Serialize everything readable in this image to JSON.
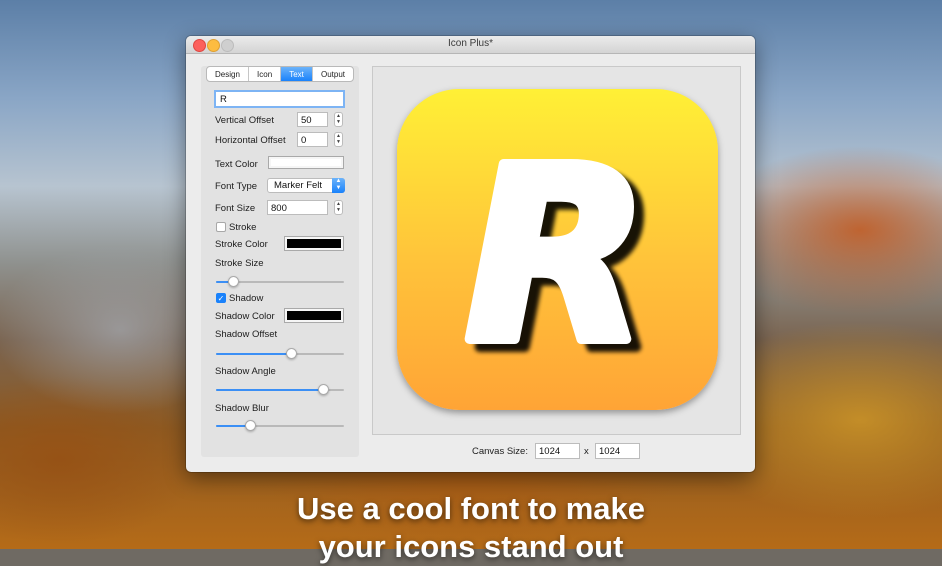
{
  "window": {
    "title": "Icon Plus*"
  },
  "tabs": [
    {
      "label": "Design",
      "active": false
    },
    {
      "label": "Icon",
      "active": false
    },
    {
      "label": "Text",
      "active": true
    },
    {
      "label": "Output",
      "active": false
    }
  ],
  "text_panel": {
    "text_value": "R",
    "vertical_offset_label": "Vertical Offset",
    "vertical_offset_value": "50",
    "horizontal_offset_label": "Horizontal Offset",
    "horizontal_offset_value": "0",
    "text_color_label": "Text Color",
    "text_color": "#ffffff",
    "font_type_label": "Font Type",
    "font_type_value": "Marker Felt",
    "font_size_label": "Font Size",
    "font_size_value": "800",
    "stroke_label": "Stroke",
    "stroke_checked": false,
    "stroke_color_label": "Stroke Color",
    "stroke_color": "#000000",
    "stroke_size_label": "Stroke Size",
    "stroke_size_level": 0.14,
    "shadow_label": "Shadow",
    "shadow_checked": true,
    "shadow_color_label": "Shadow Color",
    "shadow_color": "#000000",
    "shadow_offset_label": "Shadow Offset",
    "shadow_offset_level": 0.59,
    "shadow_angle_label": "Shadow Angle",
    "shadow_angle_level": 0.84,
    "shadow_blur_label": "Shadow Blur",
    "shadow_blur_level": 0.27
  },
  "preview": {
    "icon_letter": "R",
    "gradient_top": "#fff036",
    "gradient_bottom": "#ffa436",
    "canvas_size_label": "Canvas Size:",
    "canvas_width": "1024",
    "x_separator": "x",
    "canvas_height": "1024"
  },
  "caption": {
    "line1": "Use a cool font to make",
    "line2": "your icons stand out"
  },
  "colors": {
    "accent": "#1a82fb"
  }
}
